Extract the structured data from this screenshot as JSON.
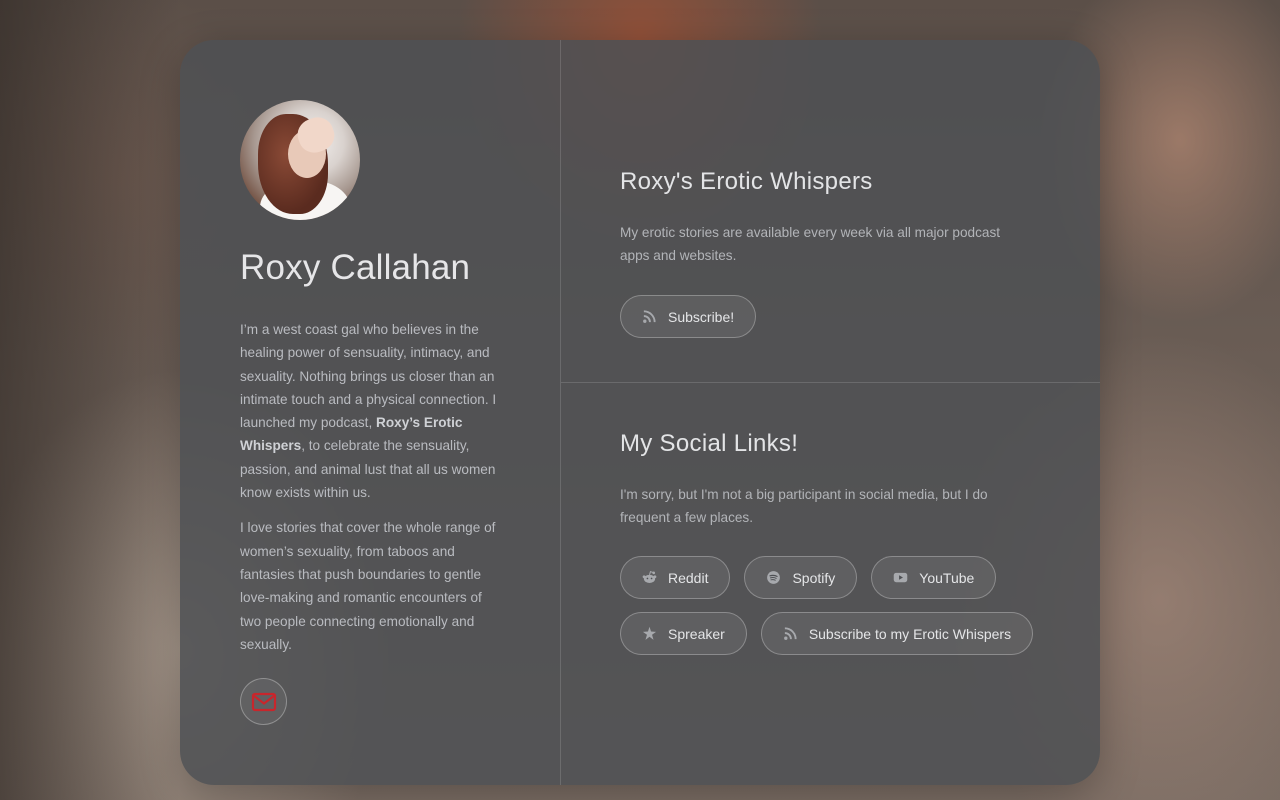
{
  "profile": {
    "name": "Roxy Callahan",
    "bio_p1_a": "I’m a west coast gal who believes in the healing power of sensuality, intimacy, and sexuality. Nothing brings us closer than an intimate touch and a physical connection. I launched my podcast, ",
    "bio_p1_bold": "Roxy’s Erotic Whispers",
    "bio_p1_b": ", to celebrate the sensuality, passion, and animal lust that all us women know exists within us.",
    "bio_p2": "I love stories that cover the whole range of women’s sexuality, from taboos and fantasies that push boundaries to gentle love-making and romantic encounters of two people connecting emotionally and sexually.",
    "mail_icon": "mail-icon",
    "mail_icon_color": "#c8262c"
  },
  "podcast": {
    "title": "Roxy's Erotic Whispers",
    "description": "My erotic stories are available every week via all major podcast apps and websites.",
    "subscribe_label": "Subscribe!",
    "subscribe_icon": "rss-icon"
  },
  "social": {
    "title": "My Social Links!",
    "description": "I'm sorry, but I'm not a big participant in social media, but I do frequent a few places.",
    "links": [
      {
        "label": "Reddit",
        "icon": "reddit-icon"
      },
      {
        "label": "Spotify",
        "icon": "spotify-icon"
      },
      {
        "label": "YouTube",
        "icon": "youtube-icon"
      },
      {
        "label": "Spreaker",
        "icon": "spreaker-icon"
      },
      {
        "label": "Subscribe to my Erotic Whispers",
        "icon": "rss-icon"
      }
    ]
  }
}
